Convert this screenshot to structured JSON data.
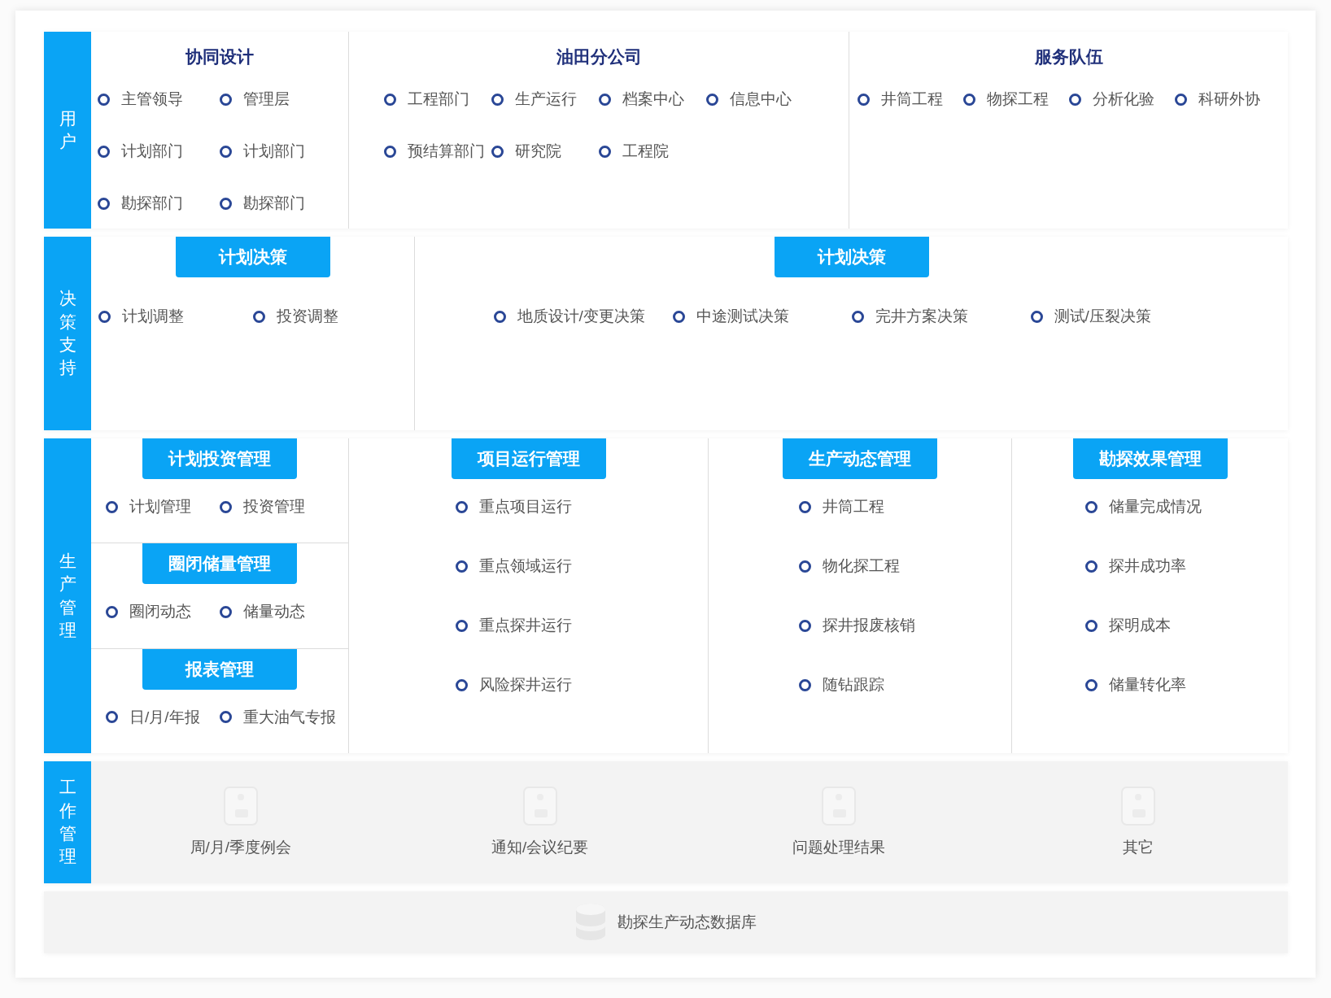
{
  "rows": [
    {
      "kind": "users",
      "label": "用户",
      "columns": [
        {
          "blocks": [
            {
              "kind": "heading",
              "title": "协同设计",
              "items": [
                "主管领导",
                "管理层",
                "计划部门",
                "计划部门",
                "勘探部门",
                "勘探部门"
              ]
            }
          ]
        },
        {
          "blocks": [
            {
              "kind": "heading",
              "title": "油田分公司",
              "items": [
                "工程部门",
                "生产运行",
                "档案中心",
                "信息中心",
                "预结算部门",
                "研究院",
                "工程院"
              ]
            }
          ]
        },
        {
          "blocks": [
            {
              "kind": "heading",
              "title": "服务队伍",
              "items": [
                "井筒工程",
                "物探工程",
                "分析化验",
                "科研外协"
              ]
            }
          ]
        }
      ]
    },
    {
      "kind": "decision",
      "label": "决策支持",
      "columns": [
        {
          "blocks": [
            {
              "kind": "tab",
              "title": "计划决策",
              "items": [
                "计划调整",
                "投资调整"
              ]
            }
          ]
        },
        {
          "blocks": [
            {
              "kind": "tab",
              "title": "计划决策",
              "items": [
                "地质设计/变更决策",
                "中途测试决策",
                "完井方案决策",
                "测试/压裂决策"
              ]
            }
          ]
        }
      ]
    },
    {
      "kind": "production",
      "label": "生产管理",
      "columns": [
        {
          "blocks": [
            {
              "kind": "tab",
              "title": "计划投资管理",
              "items": [
                "计划管理",
                "投资管理"
              ]
            },
            {
              "kind": "tab",
              "title": "圈闭储量管理",
              "items": [
                "圈闭动态",
                "储量动态"
              ]
            },
            {
              "kind": "tab",
              "title": "报表管理",
              "items": [
                "日/月/年报",
                "重大油气专报"
              ]
            }
          ]
        },
        {
          "blocks": [
            {
              "kind": "tab",
              "title": "项目运行管理",
              "items": [
                "重点项目运行",
                "重点领域运行",
                "重点探井运行",
                "风险探井运行"
              ]
            }
          ]
        },
        {
          "blocks": [
            {
              "kind": "tab",
              "title": "生产动态管理",
              "items": [
                "井筒工程",
                "物化探工程",
                "探井报废核销",
                "随钻跟踪"
              ]
            }
          ]
        },
        {
          "blocks": [
            {
              "kind": "tab",
              "title": "勘探效果管理",
              "items": [
                "储量完成情况",
                "探井成功率",
                "探明成本",
                "储量转化率"
              ]
            }
          ]
        }
      ]
    },
    {
      "kind": "work",
      "label": "工作管理",
      "items": [
        "周/月/季度例会",
        "通知/会议纪要",
        "问题处理结果",
        "其它"
      ]
    },
    {
      "kind": "database",
      "text": "勘探生产动态数据库"
    }
  ]
}
